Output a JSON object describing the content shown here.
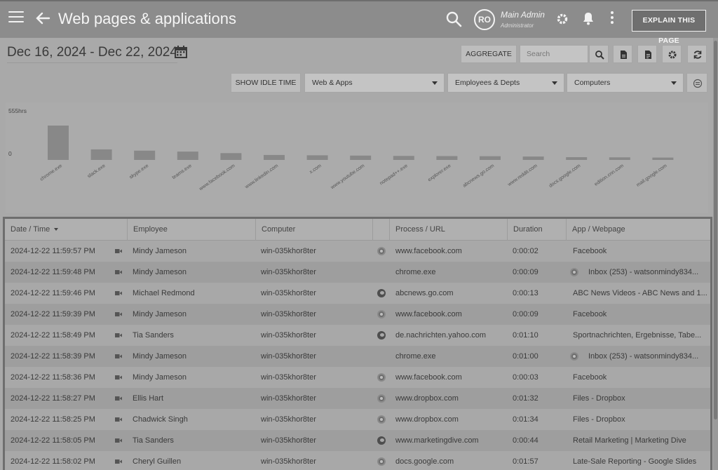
{
  "header": {
    "title": "Web pages & applications",
    "avatar_initials": "RO",
    "user_name": "Main Admin",
    "user_role": "Administrator",
    "explain_button": "EXPLAIN THIS PAGE"
  },
  "toolbar": {
    "date_range": "Dec 16, 2024 - Dec 22, 2024",
    "aggregate_button": "AGGREGATE",
    "search_placeholder": "Search",
    "show_idle_button": "SHOW IDLE TIME",
    "filter_webapps": "Web & Apps",
    "filter_employees": "Employees & Depts",
    "filter_computers": "Computers"
  },
  "chart_data": {
    "type": "bar",
    "y_top_label": "555hrs",
    "y_bottom_label": "0",
    "categories": [
      "chrome.exe",
      "slack.exe",
      "skype.exe",
      "teams.exe",
      "www.facebook.com",
      "www.linkedin.com",
      "x.com",
      "www.youtube.com",
      "notepad++.exe",
      "explorer.exe",
      "abcnews.go.com",
      "www.reddit.com",
      "docs.google.com",
      "edition.cnn.com",
      "mail.google.com"
    ],
    "values": [
      555,
      170,
      150,
      135,
      110,
      80,
      75,
      70,
      65,
      62,
      60,
      55,
      45,
      42,
      38
    ],
    "ylim": [
      0,
      555
    ]
  },
  "table": {
    "columns": [
      "Date / Time",
      "Employee",
      "Computer",
      "",
      "Process / URL",
      "Duration",
      "App / Webpage"
    ],
    "rows": [
      {
        "datetime": "2024-12-22 11:59:57 PM",
        "employee": "Mindy Jameson",
        "computer": "win-035khor8ter",
        "browser": "chrome",
        "process": "www.facebook.com",
        "duration": "0:00:02",
        "app": "Facebook",
        "app_icon": ""
      },
      {
        "datetime": "2024-12-22 11:59:48 PM",
        "employee": "Mindy Jameson",
        "computer": "win-035khor8ter",
        "browser": "",
        "process": "chrome.exe",
        "duration": "0:00:09",
        "app": "Inbox (253) - watsonmindy834...",
        "app_icon": "chrome"
      },
      {
        "datetime": "2024-12-22 11:59:46 PM",
        "employee": "Michael Redmond",
        "computer": "win-035khor8ter",
        "browser": "edge",
        "process": "abcnews.go.com",
        "duration": "0:00:13",
        "app": "ABC News Videos - ABC News and 1...",
        "app_icon": ""
      },
      {
        "datetime": "2024-12-22 11:59:39 PM",
        "employee": "Mindy Jameson",
        "computer": "win-035khor8ter",
        "browser": "chrome",
        "process": "www.facebook.com",
        "duration": "0:00:09",
        "app": "Facebook",
        "app_icon": ""
      },
      {
        "datetime": "2024-12-22 11:58:49 PM",
        "employee": "Tia Sanders",
        "computer": "win-035khor8ter",
        "browser": "edge",
        "process": "de.nachrichten.yahoo.com",
        "duration": "0:01:10",
        "app": "Sportnachrichten, Ergebnisse, Tabe...",
        "app_icon": ""
      },
      {
        "datetime": "2024-12-22 11:58:39 PM",
        "employee": "Mindy Jameson",
        "computer": "win-035khor8ter",
        "browser": "",
        "process": "chrome.exe",
        "duration": "0:01:00",
        "app": "Inbox (253) - watsonmindy834...",
        "app_icon": "chrome"
      },
      {
        "datetime": "2024-12-22 11:58:36 PM",
        "employee": "Mindy Jameson",
        "computer": "win-035khor8ter",
        "browser": "chrome",
        "process": "www.facebook.com",
        "duration": "0:00:03",
        "app": "Facebook",
        "app_icon": ""
      },
      {
        "datetime": "2024-12-22 11:58:27 PM",
        "employee": "Ellis Hart",
        "computer": "win-035khor8ter",
        "browser": "chrome",
        "process": "www.dropbox.com",
        "duration": "0:01:32",
        "app": "Files - Dropbox",
        "app_icon": ""
      },
      {
        "datetime": "2024-12-22 11:58:25 PM",
        "employee": "Chadwick Singh",
        "computer": "win-035khor8ter",
        "browser": "chrome",
        "process": "www.dropbox.com",
        "duration": "0:01:34",
        "app": "Files - Dropbox",
        "app_icon": ""
      },
      {
        "datetime": "2024-12-22 11:58:05 PM",
        "employee": "Tia Sanders",
        "computer": "win-035khor8ter",
        "browser": "edge",
        "process": "www.marketingdive.com",
        "duration": "0:00:44",
        "app": "Retail Marketing | Marketing Dive",
        "app_icon": ""
      },
      {
        "datetime": "2024-12-22 11:58:02 PM",
        "employee": "Cheryl Guillen",
        "computer": "win-035khor8ter",
        "browser": "chrome",
        "process": "docs.google.com",
        "duration": "0:01:57",
        "app": "Late-Sale Reporting - Google Slides",
        "app_icon": ""
      }
    ]
  }
}
